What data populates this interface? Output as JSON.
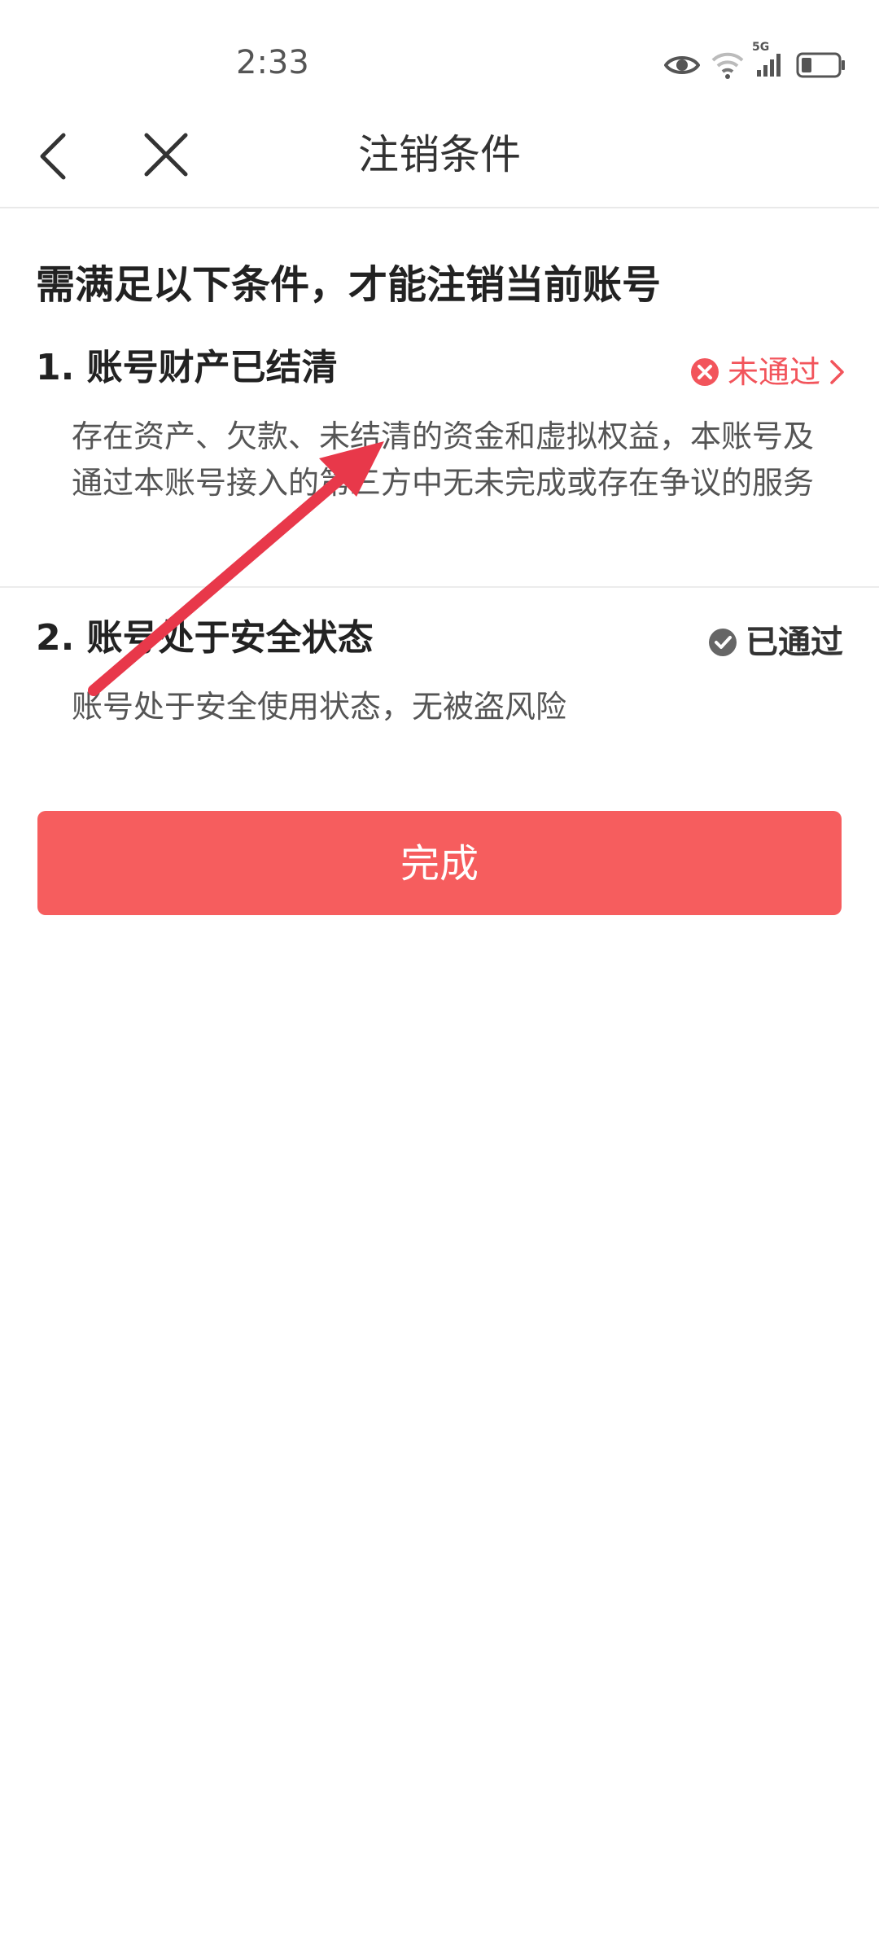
{
  "status_bar": {
    "time": "2:33",
    "network": "5G",
    "icons": [
      "eye-icon",
      "wifi-icon",
      "cellular-signal-icon",
      "battery-icon"
    ]
  },
  "nav": {
    "title": "注销条件",
    "icons": [
      "back-arrow-icon",
      "close-icon"
    ]
  },
  "content": {
    "heading": "需满足以下条件，才能注销当前账号",
    "conditions": [
      {
        "title": "1. 账号财产已结清",
        "status": "未通过",
        "status_type": "failed",
        "status_color": "#f2545b",
        "description": "存在资产、欠款、未结清的资金和虚拟权益，本账号及通过本账号接入的第三方中无未完成或存在争议的服务"
      },
      {
        "title": "2. 账号处于安全状态",
        "status": "已通过",
        "status_type": "passed",
        "status_color": "#666666",
        "description": "账号处于安全使用状态，无被盗风险"
      }
    ]
  },
  "done_button": {
    "label": "完成",
    "color": "#f65d5e"
  },
  "annotation": {
    "type": "red-arrow",
    "color": "#e8384a"
  }
}
